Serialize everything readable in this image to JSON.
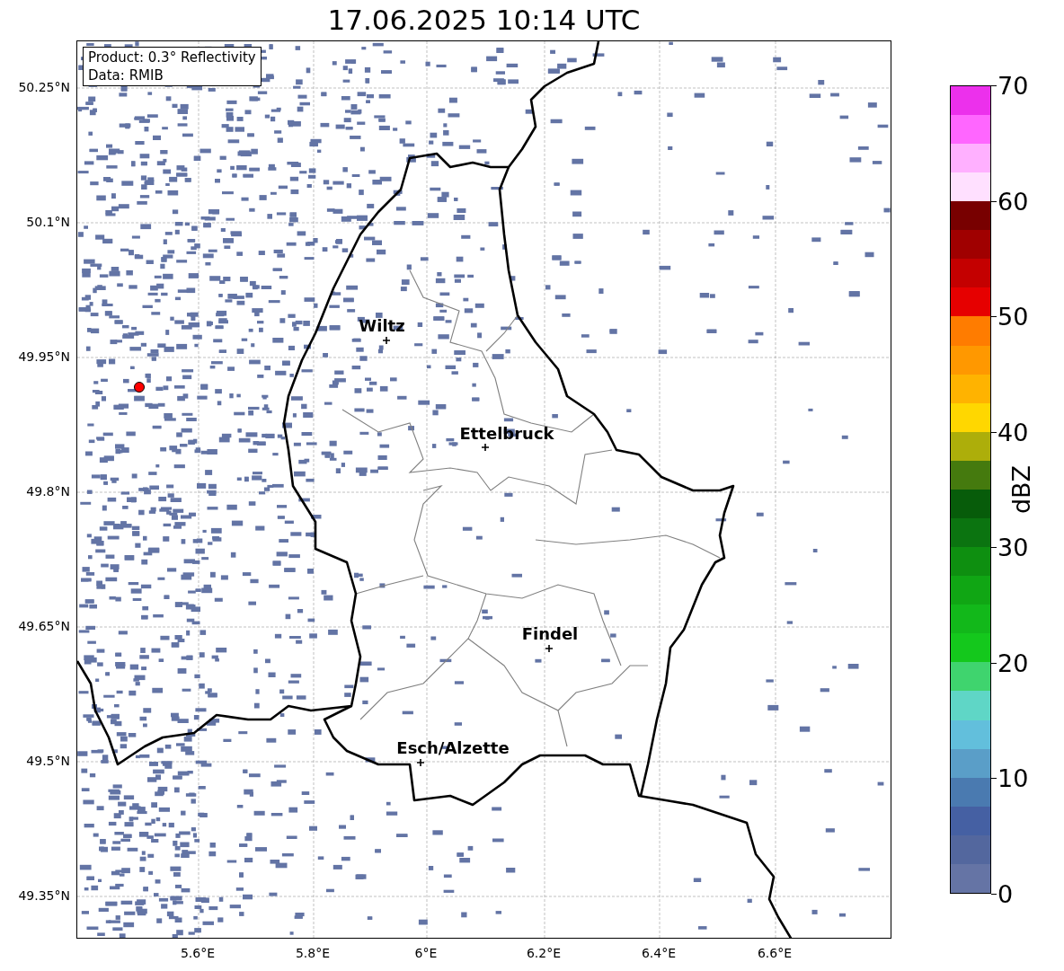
{
  "title": "17.06.2025 10:14 UTC",
  "info_box": [
    "Product: 0.3° Reflectivity",
    "Data: RMIB"
  ],
  "cities": [
    {
      "name": "Wiltz"
    },
    {
      "name": "Ettelbruck"
    },
    {
      "name": "Findel"
    },
    {
      "name": "Esch/Alzette"
    }
  ],
  "y_ticks": [
    "50.25°N",
    "50.1°N",
    "49.95°N",
    "49.8°N",
    "49.65°N",
    "49.5°N",
    "49.35°N"
  ],
  "x_ticks": [
    "5.6°E",
    "5.8°E",
    "6°E",
    "6.2°E",
    "6.4°E",
    "6.6°E"
  ],
  "colorbar": {
    "label": "dBZ",
    "ticks": [
      "70",
      "60",
      "50",
      "40",
      "30",
      "20",
      "10",
      "0"
    ],
    "segments": [
      {
        "color": "#6574a5"
      },
      {
        "color": "#53679e"
      },
      {
        "color": "#4560a3"
      },
      {
        "color": "#4a7ab0"
      },
      {
        "color": "#5a9ec8"
      },
      {
        "color": "#62bfdc"
      },
      {
        "color": "#5fd6c6"
      },
      {
        "color": "#3fd46e"
      },
      {
        "color": "#14c81c"
      },
      {
        "color": "#12b81a"
      },
      {
        "color": "#10a614"
      },
      {
        "color": "#0e8f10"
      },
      {
        "color": "#0b7410"
      },
      {
        "color": "#075c0a"
      },
      {
        "color": "#457a0e"
      },
      {
        "color": "#adae0a"
      },
      {
        "color": "#ffd700"
      },
      {
        "color": "#ffb300"
      },
      {
        "color": "#ff9800"
      },
      {
        "color": "#ff7c00"
      },
      {
        "color": "#e60000"
      },
      {
        "color": "#c40000"
      },
      {
        "color": "#a00000"
      },
      {
        "color": "#780000"
      },
      {
        "color": "#ffe0ff"
      },
      {
        "color": "#ffb0ff"
      },
      {
        "color": "#ff66ff"
      },
      {
        "color": "#ec30ec"
      }
    ]
  }
}
